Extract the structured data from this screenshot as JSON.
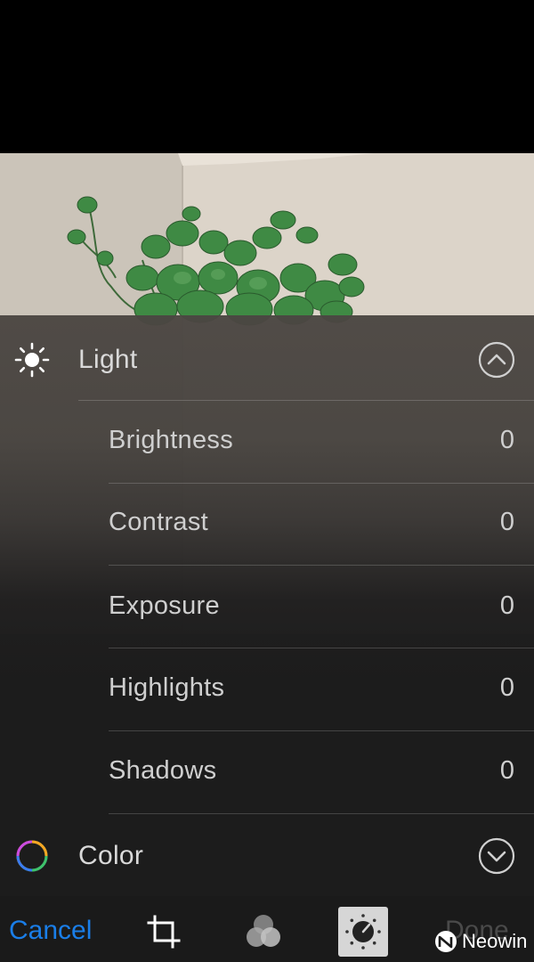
{
  "sections": {
    "light": {
      "label": "Light",
      "icon": "sun-icon",
      "state": "expanded"
    },
    "color": {
      "label": "Color",
      "icon": "color-wheel-icon",
      "state": "collapsed"
    }
  },
  "adjustments": [
    {
      "label": "Brightness",
      "value": "0"
    },
    {
      "label": "Contrast",
      "value": "0"
    },
    {
      "label": "Exposure",
      "value": "0"
    },
    {
      "label": "Highlights",
      "value": "0"
    },
    {
      "label": "Shadows",
      "value": "0"
    }
  ],
  "toolbar": {
    "cancel_label": "Cancel",
    "done_label": "Done",
    "tools": [
      "crop-icon",
      "filters-icon",
      "adjust-dial-icon"
    ],
    "active_tool": "adjust-dial-icon"
  },
  "watermark": {
    "text": "Neowin"
  },
  "colors": {
    "accent": "#1a7ee8",
    "done_disabled": "#4a4a4a",
    "text": "#cfcfcf"
  }
}
